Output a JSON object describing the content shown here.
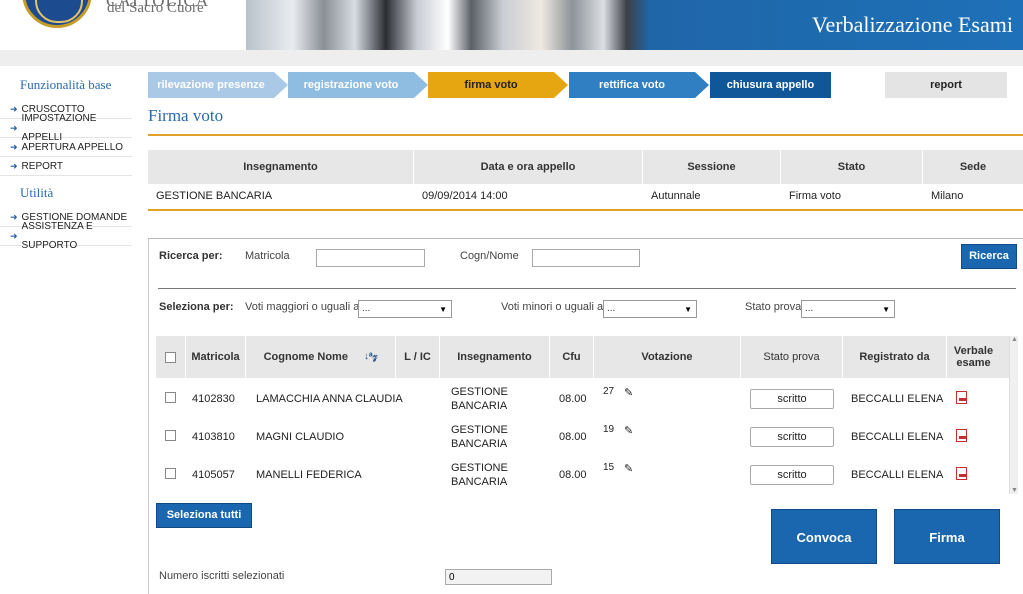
{
  "header": {
    "brand_top": "CATTOLICA",
    "brand_sub": "del Sacro Cuore",
    "title": "Verbalizzazione Esami"
  },
  "sidebar": {
    "base_heading": "Funzionalità base",
    "base_items": [
      {
        "label": "CRUSCOTTO"
      },
      {
        "label": "IMPOSTAZIONE APPELLI"
      },
      {
        "label": "APERTURA APPELLO"
      },
      {
        "label": "REPORT"
      }
    ],
    "util_heading": "Utilità",
    "util_items": [
      {
        "label": "GESTIONE DOMANDE"
      },
      {
        "label": "ASSISTENZA E SUPPORTO"
      }
    ]
  },
  "steps": [
    {
      "label": "rilevazione presenze",
      "color": "#a9c9e6"
    },
    {
      "label": "registrazione voto",
      "color": "#8fbde2"
    },
    {
      "label": "firma voto",
      "color": "#e5a612"
    },
    {
      "label": "rettifica voto",
      "color": "#2f7fc2"
    },
    {
      "label": "chiusura appello",
      "color": "#0f5799"
    }
  ],
  "report_label": "report",
  "page_title": "Firma voto",
  "info_table": {
    "headers": [
      "Insegnamento",
      "Data e ora appello",
      "Sessione",
      "Stato",
      "Sede"
    ],
    "row": [
      "GESTIONE BANCARIA",
      "09/09/2014 14:00",
      "Autunnale",
      "Firma voto",
      "Milano"
    ]
  },
  "search": {
    "ricerca_per": "Ricerca per:",
    "matricola_label": "Matricola",
    "matricola_value": "",
    "cognome_label": "Cogn/Nome",
    "cognome_value": "",
    "ricerca_button": "Ricerca"
  },
  "filters": {
    "seleziona_per": "Seleziona per:",
    "voti_maggiori_label": "Voti maggiori o uguali a",
    "voti_maggiori_value": "...",
    "voti_minori_label": "Voti minori o uguali a",
    "voti_minori_value": "...",
    "stato_prova_label": "Stato prova",
    "stato_prova_value": "..."
  },
  "results": {
    "headers": {
      "matricola": "Matricola",
      "cognome_nome": "Cognome Nome",
      "l_ic": "L / IC",
      "insegnamento": "Insegnamento",
      "cfu": "Cfu",
      "votazione": "Votazione",
      "stato_prova": "Stato prova",
      "registrato_da": "Registrato da",
      "verbale_esame": "Verbale esame"
    },
    "rows": [
      {
        "matricola": "4102830",
        "nome": "LAMACCHIA ANNA CLAUDIA",
        "ins1": "GESTIONE",
        "ins2": "BANCARIA",
        "cfu": "08.00",
        "voto": "27",
        "stato": "scritto",
        "registrato": "BECCALLI ELENA"
      },
      {
        "matricola": "4103810",
        "nome": "MAGNI CLAUDIO",
        "ins1": "GESTIONE",
        "ins2": "BANCARIA",
        "cfu": "08.00",
        "voto": "19",
        "stato": "scritto",
        "registrato": "BECCALLI ELENA"
      },
      {
        "matricola": "4105057",
        "nome": "MANELLI FEDERICA",
        "ins1": "GESTIONE",
        "ins2": "BANCARIA",
        "cfu": "08.00",
        "voto": "15",
        "stato": "scritto",
        "registrato": "BECCALLI ELENA"
      }
    ]
  },
  "actions": {
    "seleziona_tutti": "Seleziona tutti",
    "convoca": "Convoca",
    "firma": "Firma"
  },
  "footer": {
    "numero_label": "Numero iscritti selezionati",
    "numero_value": "0"
  }
}
